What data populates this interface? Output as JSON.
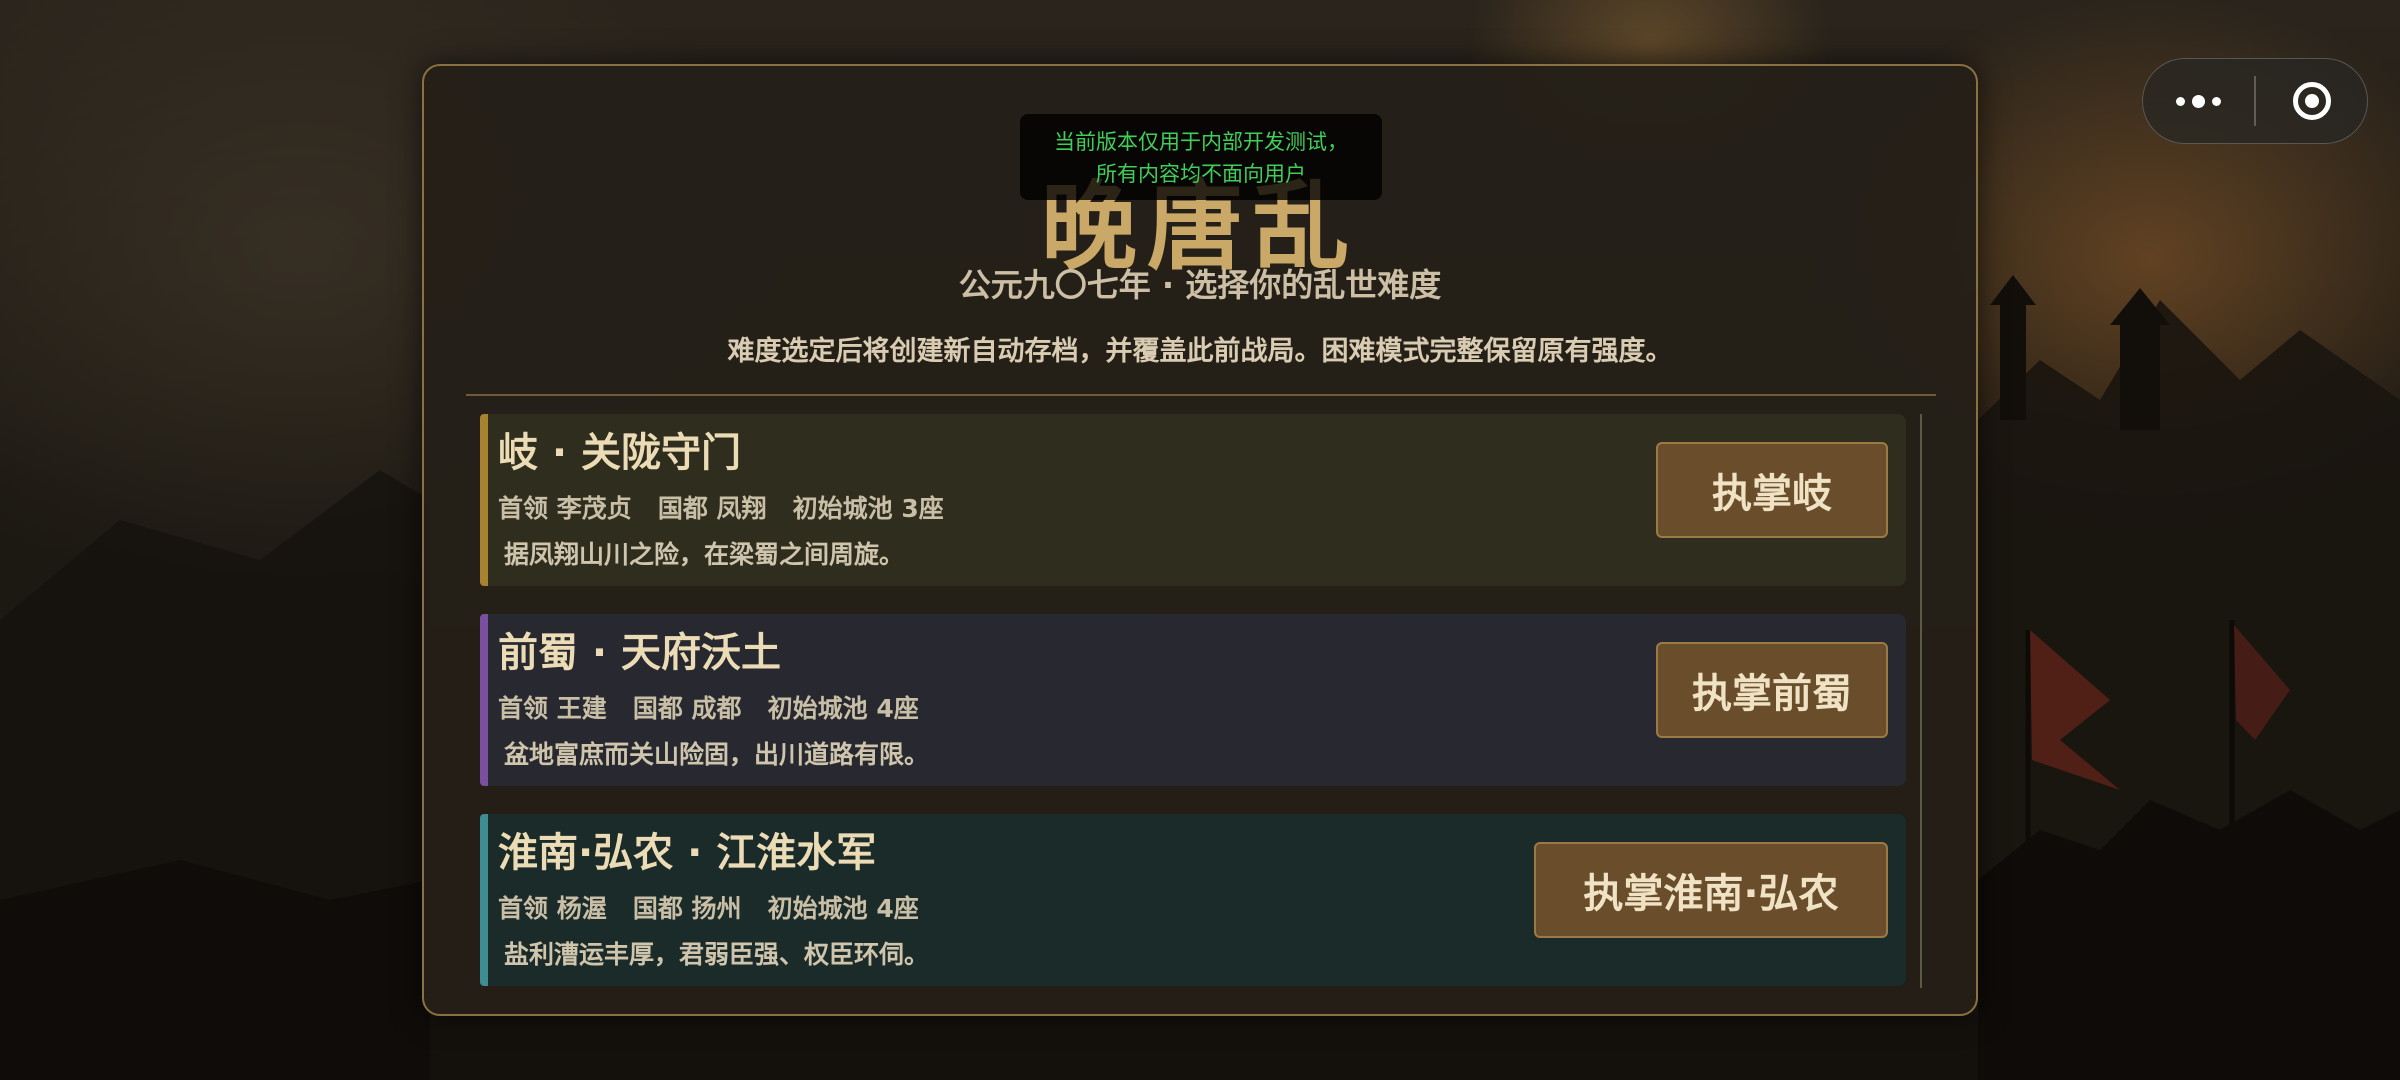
{
  "colors": {
    "panel_border": "#8a7142",
    "title": "#c9a868",
    "notice_text": "#3fcf58",
    "button_bg": "#6a4e2b",
    "button_border": "#9c7a45",
    "faction_qi_accent": "#a98230",
    "faction_shu_accent": "#7a4fa0",
    "faction_huainan_accent": "#3f8d94"
  },
  "capsule": {
    "more_icon": "more-dots-icon",
    "close_icon": "target-circle-icon"
  },
  "header": {
    "title": "晚唐乱",
    "notice_line1": "当前版本仅用于内部开发测试，",
    "notice_line2": "所有内容均不面向用户",
    "subtitle": "公元九〇七年 · 选择你的乱世难度",
    "description": "难度选定后将创建新自动存档，并覆盖此前战局。困难模式完整保留原有强度。"
  },
  "factions": [
    {
      "name": "岐 · 关陇守门",
      "meta": "首领 李茂贞   国都 凤翔   初始城池 3座",
      "intro": "据凤翔山川之险，在梁蜀之间周旋。",
      "button": "执掌岐"
    },
    {
      "name": "前蜀 · 天府沃土",
      "meta": "首领 王建   国都 成都   初始城池 4座",
      "intro": "盆地富庶而关山险固，出川道路有限。",
      "button": "执掌前蜀"
    },
    {
      "name": "淮南·弘农 · 江淮水军",
      "meta": "首领 杨渥   国都 扬州   初始城池 4座",
      "intro": "盐利漕运丰厚，君弱臣强、权臣环伺。",
      "button": "执掌淮南·弘农"
    }
  ]
}
